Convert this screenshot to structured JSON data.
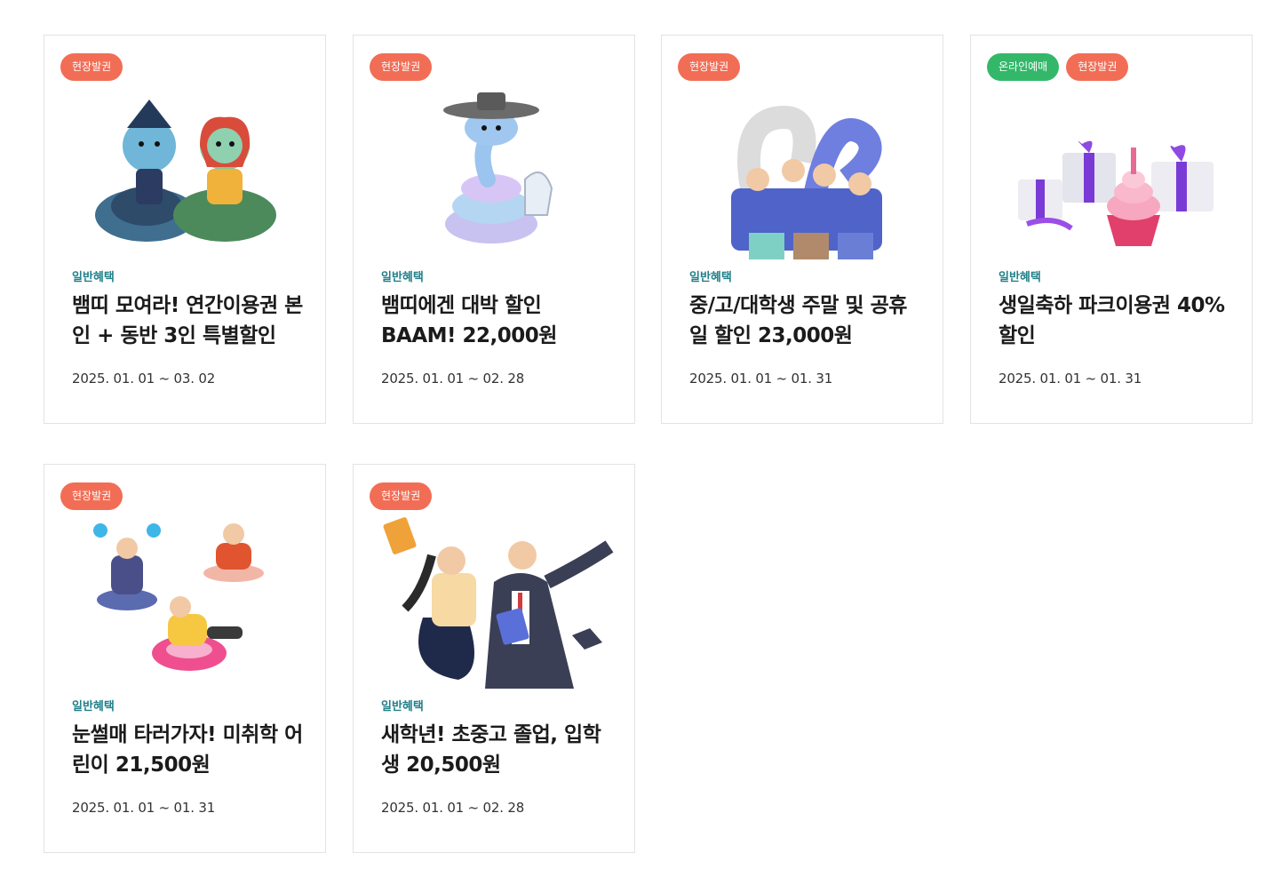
{
  "colors": {
    "onsite_badge": "#f26d55",
    "online_badge": "#33b86a",
    "category": "#21808a"
  },
  "cards": [
    {
      "badges": [
        "현장발권"
      ],
      "category": "일반혜택",
      "title": "뱀띠 모여라! 연간이용권 본인 + 동반 3인 특별할인",
      "date": "2025. 01. 01 ~ 03. 02",
      "image": "snake-couple-hanbok-illustration"
    },
    {
      "badges": [
        "현장발권"
      ],
      "category": "일반혜택",
      "title": "뱀띠에겐 대박 할인 BAAM! 22,000원",
      "date": "2025. 01. 01 ~ 02. 28",
      "image": "snake-with-gat-hat-illustration"
    },
    {
      "badges": [
        "현장발권"
      ],
      "category": "일반혜택",
      "title": "중/고/대학생 주말 및 공휴일 할인 23,000원",
      "date": "2025. 01. 01 ~ 01. 31",
      "image": "cheering-students-illustration"
    },
    {
      "badges": [
        "온라인예매",
        "현장발권"
      ],
      "category": "일반혜택",
      "title": "생일축하 파크이용권 40%할인",
      "date": "2025. 01. 01 ~ 01. 31",
      "image": "gift-boxes-cupcake-illustration"
    },
    {
      "badges": [
        "현장발권"
      ],
      "category": "일반혜택",
      "title": "눈썰매 타러가자! 미취학 어린이 21,500원",
      "date": "2025. 01. 01 ~ 01. 31",
      "image": "snow-sled-kids-illustration"
    },
    {
      "badges": [
        "현장발권"
      ],
      "category": "일반혜택",
      "title": "새학년! 초중고 졸업, 입학생 20,500원",
      "date": "2025. 01. 01 ~ 02. 28",
      "image": "graduation-students-illustration"
    }
  ]
}
